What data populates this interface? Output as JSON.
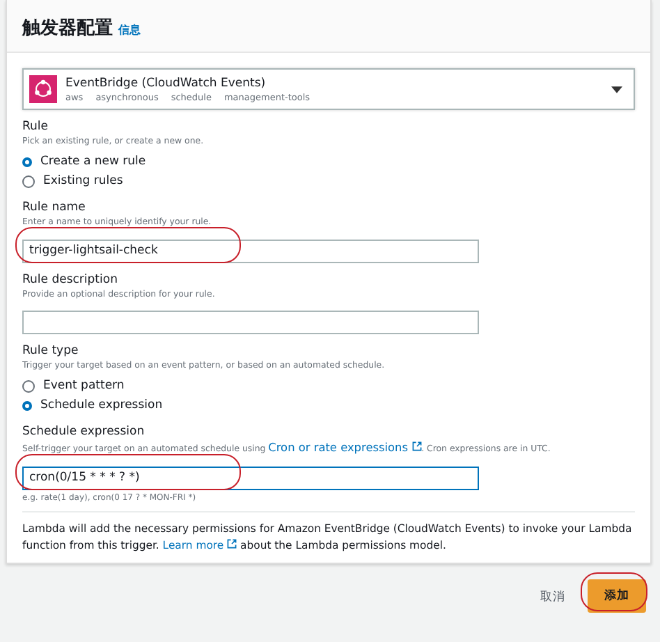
{
  "header": {
    "title": "触发器配置",
    "info_link": "信息"
  },
  "source_select": {
    "name": "EventBridge (CloudWatch Events)",
    "tags": [
      "aws",
      "asynchronous",
      "schedule",
      "management-tools"
    ]
  },
  "rule": {
    "label": "Rule",
    "hint": "Pick an existing rule, or create a new one.",
    "options": [
      {
        "label": "Create a new rule",
        "selected": true
      },
      {
        "label": "Existing rules",
        "selected": false
      }
    ]
  },
  "rule_name": {
    "label": "Rule name",
    "hint": "Enter a name to uniquely identify your rule.",
    "value": "trigger-lightsail-check",
    "highlighted": true
  },
  "rule_description": {
    "label": "Rule description",
    "hint": "Provide an optional description for your rule."
  },
  "rule_type": {
    "label": "Rule type",
    "hint": "Trigger your target based on an event pattern, or based on an automated schedule.",
    "options": [
      {
        "label": "Event pattern",
        "selected": false
      },
      {
        "label": "Schedule expression",
        "selected": true
      }
    ]
  },
  "schedule_expression": {
    "label": "Schedule expression",
    "hint_before": "Self-trigger your target on an automated schedule using",
    "hint_link": "Cron or rate expressions",
    "hint_after": ". Cron expressions are in UTC.",
    "value": "cron(0/15 * * * ? *)",
    "example": "e.g. rate(1 day), cron(0 17 ? * MON-FRI *)",
    "highlighted": true
  },
  "permissions_note": {
    "before": "Lambda will add the necessary permissions for Amazon EventBridge (CloudWatch Events) to invoke your Lambda function from this trigger.",
    "link": "Learn more",
    "after": "about the Lambda permissions model."
  },
  "buttons": [
    {
      "label": "取消",
      "kind": "link"
    },
    {
      "label": "添加",
      "kind": "primary",
      "highlighted": true
    }
  ]
}
